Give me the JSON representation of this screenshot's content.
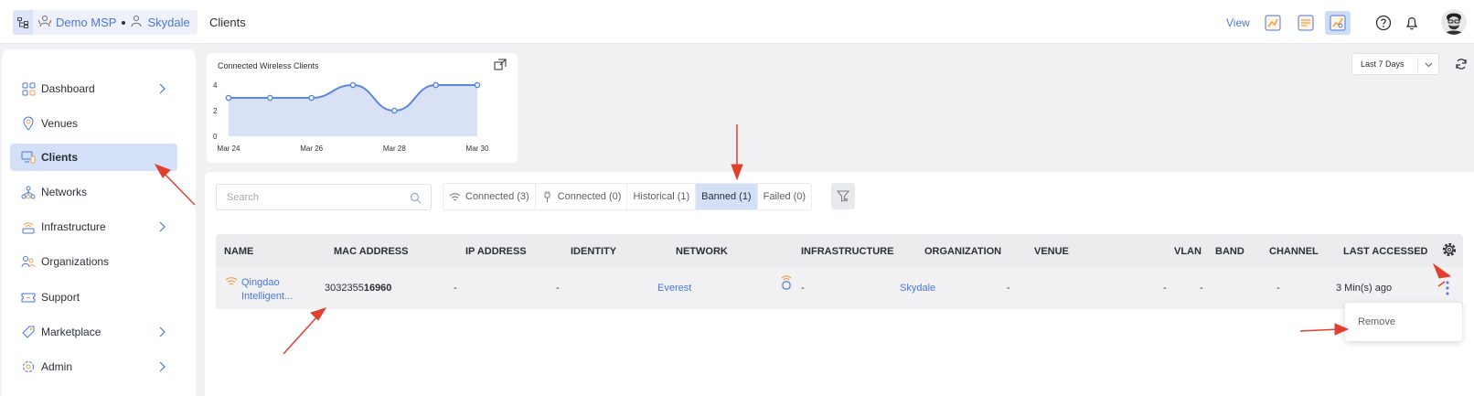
{
  "header": {
    "breadcrumb": {
      "msp": "Demo MSP",
      "org": "Skydale"
    },
    "page_title": "Clients",
    "view_label": "View",
    "icons": [
      "dashboard-view-icon",
      "report-view-icon",
      "analytics-view-icon",
      "help-icon",
      "bell-icon",
      "avatar"
    ]
  },
  "sidebar": {
    "items": [
      {
        "label": "Dashboard",
        "icon": "dashboard-icon",
        "has_chevron": true
      },
      {
        "label": "Venues",
        "icon": "location-pin-icon",
        "has_chevron": false
      },
      {
        "label": "Clients",
        "icon": "clients-icon",
        "has_chevron": false,
        "active": true
      },
      {
        "label": "Networks",
        "icon": "network-icon",
        "has_chevron": false
      },
      {
        "label": "Infrastructure",
        "icon": "access-point-icon",
        "has_chevron": true
      },
      {
        "label": "Organizations",
        "icon": "organizations-icon",
        "has_chevron": false
      },
      {
        "label": "Support",
        "icon": "ticket-icon",
        "has_chevron": false
      },
      {
        "label": "Marketplace",
        "icon": "tag-icon",
        "has_chevron": true
      },
      {
        "label": "Admin",
        "icon": "admin-gear-icon",
        "has_chevron": true
      }
    ]
  },
  "chart_data": {
    "type": "area",
    "title": "Connected Wireless Clients",
    "x": [
      "Mar 24",
      "Mar 25",
      "Mar 26",
      "Mar 27",
      "Mar 28",
      "Mar 29",
      "Mar 30"
    ],
    "x_tick_labels": [
      "Mar 24",
      "Mar 26",
      "Mar 28",
      "Mar 30"
    ],
    "values": [
      3,
      3,
      3,
      4,
      2,
      4,
      4
    ],
    "y_ticks": [
      0,
      2,
      4
    ],
    "ylim": [
      0,
      4.5
    ],
    "xlabel": "",
    "ylabel": "",
    "color": "#5b86dc",
    "fill": "#d8e1f6",
    "grid": false
  },
  "range": {
    "selected": "Last 7 Days"
  },
  "search": {
    "placeholder": "Search"
  },
  "tabs": [
    {
      "label": "Connected (3)",
      "icon": "wifi-icon"
    },
    {
      "label": "Connected (0)",
      "icon": "wired-icon"
    },
    {
      "label": "Historical (1)"
    },
    {
      "label": "Banned (1)",
      "active": true
    },
    {
      "label": "Failed (0)"
    }
  ],
  "table": {
    "columns": [
      "NAME",
      "MAC ADDRESS",
      "IP ADDRESS",
      "IDENTITY",
      "NETWORK",
      "INFRASTRUCTURE",
      "ORGANIZATION",
      "VENUE",
      "VLAN",
      "BAND",
      "CHANNEL",
      "LAST ACCESSED"
    ],
    "rows": [
      {
        "name_line1": "Qingdao",
        "name_line2": "Intelligent...",
        "mac_prefix": "3032355",
        "mac_suffix": "16960",
        "ip": "-",
        "identity": "-",
        "network": "Everest",
        "infrastructure": "-",
        "organization": "Skydale",
        "venue": "-",
        "vlan": "-",
        "band": "-",
        "channel": "-",
        "last_accessed": "3 Min(s) ago"
      }
    ]
  },
  "row_menu": {
    "remove": "Remove"
  },
  "colors": {
    "accent": "#4a78d8",
    "active_bg": "#d3e0f8",
    "arrow": "#e0412f",
    "wifi": "#f0a04b"
  }
}
